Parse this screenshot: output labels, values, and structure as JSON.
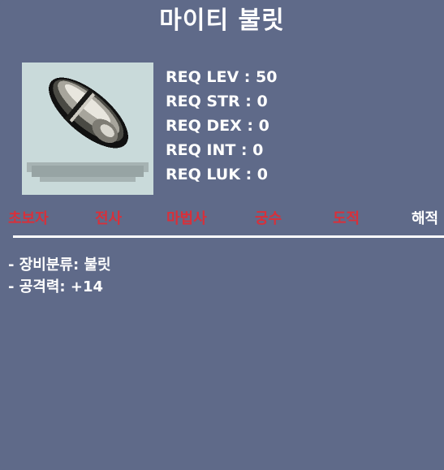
{
  "item": {
    "name": "마이티 불릿",
    "icon": "bullet-icon",
    "requirements": [
      "REQ LEV : 50",
      "REQ STR : 0",
      "REQ DEX : 0",
      "REQ INT : 0",
      "REQ LUK : 0"
    ],
    "jobs": [
      {
        "label": "초보자",
        "allowed": false
      },
      {
        "label": "전사",
        "allowed": false
      },
      {
        "label": "마법사",
        "allowed": false
      },
      {
        "label": "궁수",
        "allowed": false
      },
      {
        "label": "도적",
        "allowed": false
      },
      {
        "label": "해적",
        "allowed": true
      }
    ],
    "properties": [
      "- 장비분류: 불릿",
      "- 공격력: +14"
    ]
  },
  "colors": {
    "background": "#5f6a89",
    "icon_background": "#c9dada",
    "job_disallowed": "#d8303a",
    "job_allowed": "#ffffff"
  }
}
